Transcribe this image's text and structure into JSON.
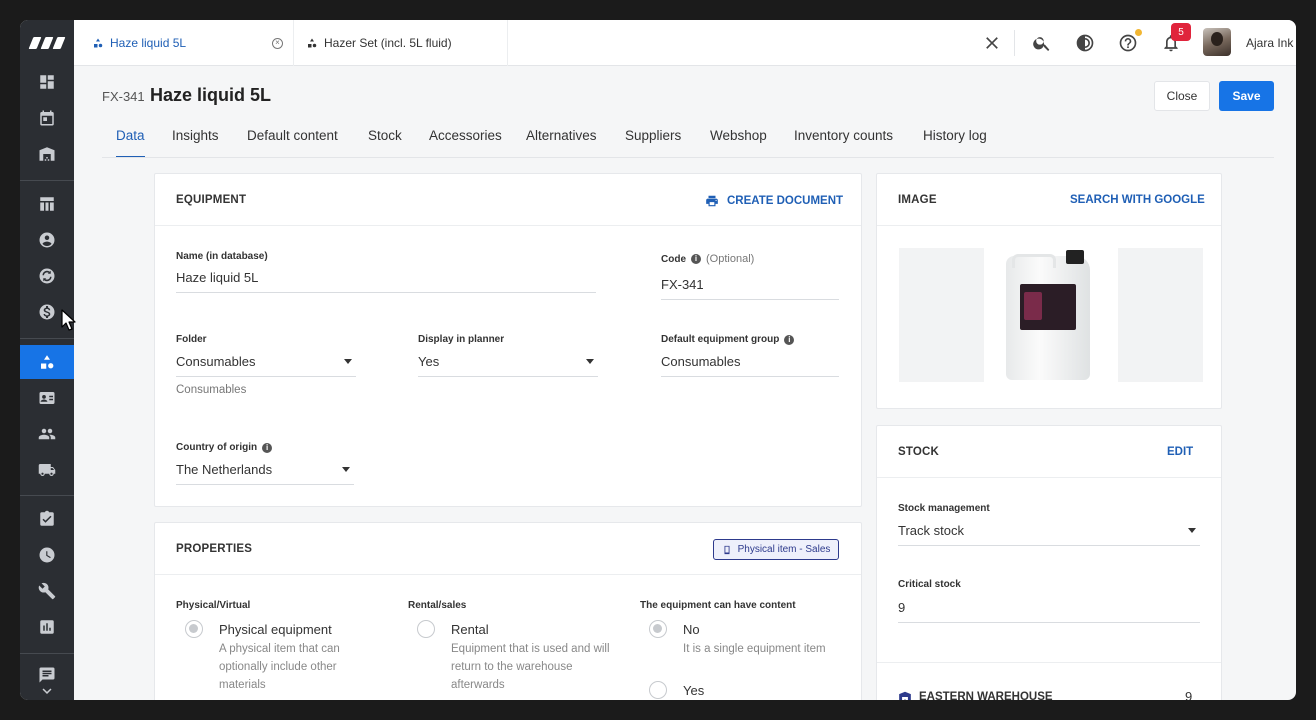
{
  "topbar": {
    "tabs": [
      {
        "label": "Haze liquid 5L",
        "icon": "equipment-icon",
        "active": true
      },
      {
        "label": "Hazer Set (incl. 5L fluid)",
        "icon": "equipment-icon",
        "active": false
      }
    ],
    "notifications_count": "5",
    "user_name": "Ajara Ink"
  },
  "sidebar": {
    "items": [
      {
        "icon": "dashboard-icon"
      },
      {
        "icon": "calendar-icon"
      },
      {
        "icon": "warehouse-icon"
      },
      {
        "icon": "table-icon"
      },
      {
        "icon": "contact-icon"
      },
      {
        "icon": "sync-icon"
      },
      {
        "icon": "dollar-icon"
      },
      {
        "icon": "equipment-icon",
        "active": true
      },
      {
        "icon": "id-card-icon"
      },
      {
        "icon": "people-icon"
      },
      {
        "icon": "truck-icon"
      },
      {
        "icon": "clipboard-check-icon"
      },
      {
        "icon": "clock-icon"
      },
      {
        "icon": "wrench-icon"
      },
      {
        "icon": "bar-chart-icon"
      },
      {
        "icon": "message-icon"
      }
    ]
  },
  "header": {
    "code": "FX-341",
    "title": "Haze liquid 5L",
    "close_label": "Close",
    "save_label": "Save"
  },
  "page_tabs": [
    "Data",
    "Insights",
    "Default content",
    "Stock",
    "Accessories",
    "Alternatives",
    "Suppliers",
    "Webshop",
    "Inventory counts",
    "History log"
  ],
  "equipment": {
    "title": "EQUIPMENT",
    "action": "CREATE DOCUMENT",
    "name_label": "Name (in database)",
    "name_value": "Haze liquid 5L",
    "code_label": "Code",
    "code_optional": "(Optional)",
    "code_value": "FX-341",
    "folder_label": "Folder",
    "folder_value": "Consumables",
    "folder_hint": "Consumables",
    "planner_label": "Display in planner",
    "planner_value": "Yes",
    "group_label": "Default equipment group",
    "group_value": "Consumables",
    "country_label": "Country of origin",
    "country_value": "The Netherlands"
  },
  "properties": {
    "title": "PROPERTIES",
    "chip": "Physical item - Sales",
    "col1_label": "Physical/Virtual",
    "col1_option": "Physical equipment",
    "col1_desc": "A physical item that can optionally include other materials",
    "col2_label": "Rental/sales",
    "col2_option": "Rental",
    "col2_desc": "Equipment that is used and will return to the warehouse afterwards",
    "col3_label": "The equipment can have content",
    "col3_option_no": "No",
    "col3_desc": "It is a single equipment item",
    "col3_option_yes": "Yes"
  },
  "image_card": {
    "title": "IMAGE",
    "action": "SEARCH WITH GOOGLE"
  },
  "stock_card": {
    "title": "STOCK",
    "action": "EDIT",
    "mgmt_label": "Stock management",
    "mgmt_value": "Track stock",
    "critical_label": "Critical stock",
    "critical_value": "9",
    "warehouse_name": "EASTERN WAREHOUSE",
    "warehouse_count": "9"
  },
  "colors": {
    "accent": "#1774e6",
    "link": "#1f5fb5",
    "sidebar": "#2b2e33",
    "badge": "#e0243c"
  }
}
